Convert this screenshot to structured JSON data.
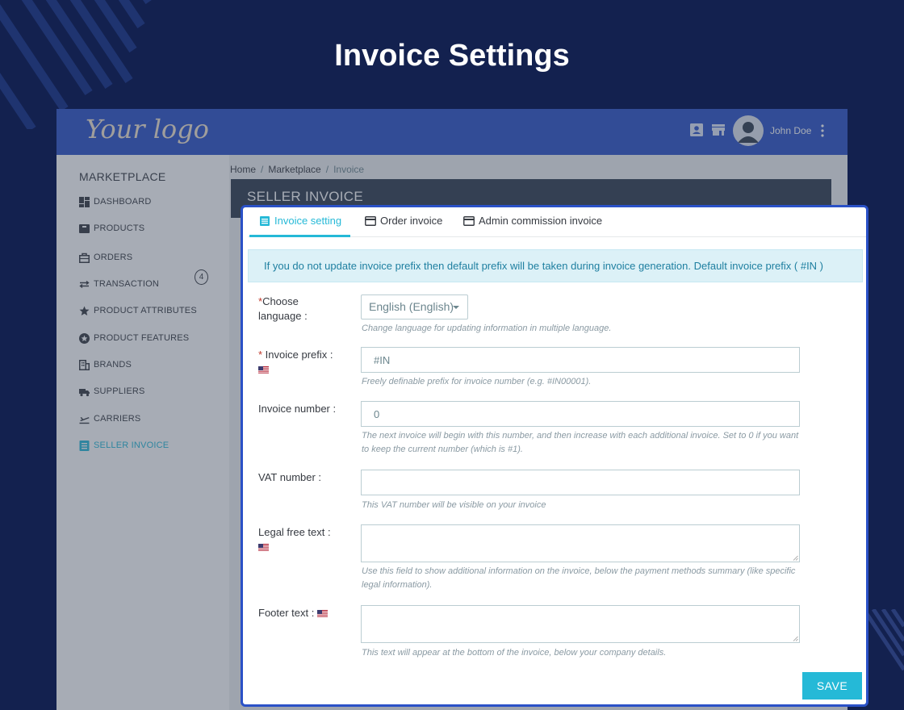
{
  "page_title": "Invoice Settings",
  "app": {
    "logo_text": "Your logo",
    "user_name": "John Doe",
    "top_icons": [
      "contact-card-icon",
      "store-icon"
    ]
  },
  "sidebar": {
    "title": "MARKETPLACE",
    "items": [
      {
        "label": "DASHBOARD",
        "icon": "dashboard-icon"
      },
      {
        "label": "PRODUCTS",
        "icon": "products-icon",
        "badge": "4"
      },
      {
        "label": "ORDERS",
        "icon": "orders-icon"
      },
      {
        "label": "TRANSACTION",
        "icon": "transaction-icon"
      },
      {
        "label": "PRODUCT ATTRIBUTES",
        "icon": "attributes-icon"
      },
      {
        "label": "PRODUCT FEATURES",
        "icon": "features-icon"
      },
      {
        "label": "BRANDS",
        "icon": "brands-icon"
      },
      {
        "label": "SUPPLIERS",
        "icon": "truck-icon"
      },
      {
        "label": "CARRIERS",
        "icon": "plane-icon"
      },
      {
        "label": "SELLER INVOICE",
        "icon": "invoice-icon",
        "active": true
      }
    ]
  },
  "breadcrumb": {
    "items": [
      "Home",
      "Marketplace"
    ],
    "current": "Invoice"
  },
  "header_title": "SELLER INVOICE",
  "tabs": [
    {
      "label": "Invoice setting",
      "active": true
    },
    {
      "label": "Order invoice"
    },
    {
      "label": "Admin commission invoice"
    }
  ],
  "alert": "If you do not update invoice prefix then default prefix will be taken during invoice generation. Default invoice prefix ( #IN )",
  "form": {
    "language": {
      "required_mark": "*",
      "label_line1": "Choose",
      "label_line2": "language :",
      "value": "English (English)",
      "help": "Change language for updating information in multiple language."
    },
    "prefix": {
      "required_mark": "*",
      "label": " Invoice prefix :",
      "value": "#IN",
      "help": "Freely definable prefix for invoice number (e.g. #IN00001)."
    },
    "number": {
      "label": "Invoice number :",
      "value": "0",
      "help": "The next invoice will begin with this number, and then increase with each additional invoice. Set to 0 if you want to keep the current number (which is #1)."
    },
    "vat": {
      "label": "VAT number :",
      "value": "",
      "help": "This VAT number will be visible on your invoice"
    },
    "legal": {
      "label": "Legal free text :",
      "value": "",
      "help": "Use this field to show additional information on the invoice, below the payment methods summary (like specific legal information)."
    },
    "footer": {
      "label": "Footer text :",
      "value": "",
      "help": "This text will appear at the bottom of the invoice, below your company details."
    }
  },
  "save_label": "SAVE",
  "colors": {
    "background": "#13214f",
    "topbar": "#2a51c7",
    "accent": "#25b9d7",
    "header_bar": "#2e3b4e"
  }
}
